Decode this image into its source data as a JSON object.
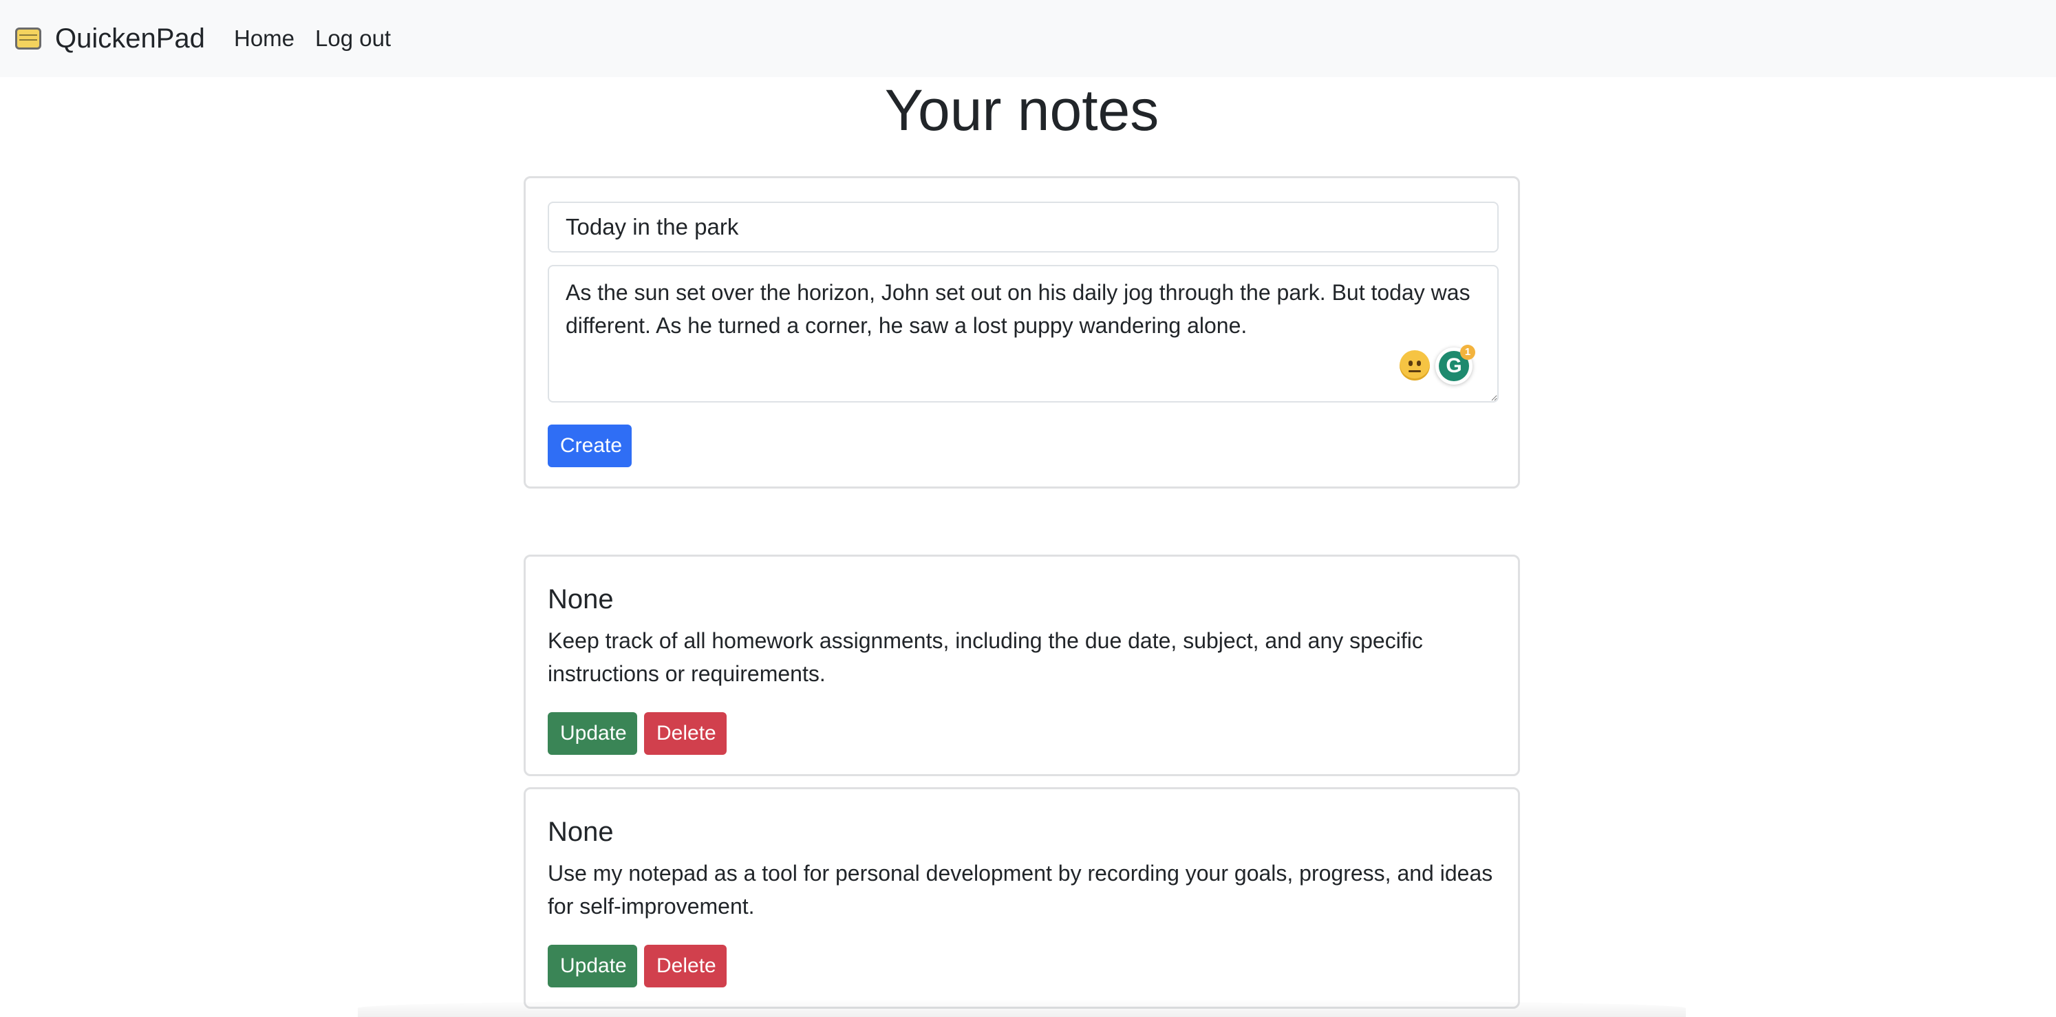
{
  "app": {
    "brand": "QuickenPad",
    "brand_icon": "notepad-icon"
  },
  "nav": {
    "home_label": "Home",
    "logout_label": "Log out"
  },
  "page": {
    "title": "Your notes"
  },
  "create_form": {
    "title_value": "Today in the park",
    "body_value": "As the sun set over the horizon, John set out on his daily jog through the park. But today was different. As he turned a corner, he saw a lost puppy wandering alone.",
    "create_label": "Create",
    "grammarly_count": "1"
  },
  "notes": [
    {
      "title": "None",
      "body": "Keep track of all homework assignments, including the due date, subject, and any specific instructions or requirements.",
      "update_label": "Update",
      "delete_label": "Delete"
    },
    {
      "title": "None",
      "body": "Use my notepad as a tool for personal development by recording your goals, progress, and ideas for self-improvement.",
      "update_label": "Update",
      "delete_label": "Delete"
    }
  ],
  "colors": {
    "primary": "#2f6ef5",
    "success": "#3a8556",
    "danger": "#d1404d",
    "navbar_bg": "#f8f9fa"
  }
}
